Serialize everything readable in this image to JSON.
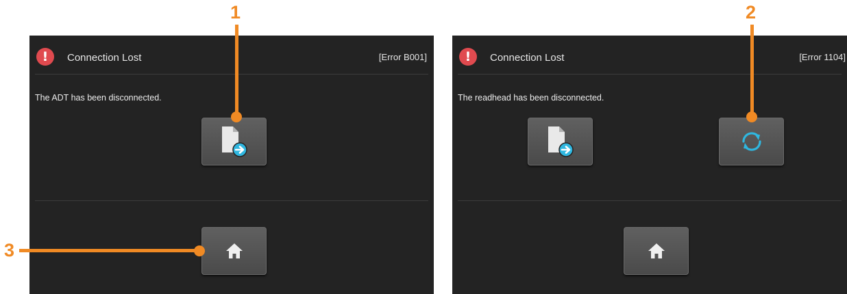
{
  "callouts": [
    {
      "label": "1"
    },
    {
      "label": "2"
    },
    {
      "label": "3"
    }
  ],
  "screens": [
    {
      "title": "Connection Lost",
      "error_code": "[Error B001]",
      "message": "The ADT has been disconnected.",
      "buttons": [
        "export-report-icon",
        "home-icon"
      ]
    },
    {
      "title": "Connection Lost",
      "error_code": "[Error 1104]",
      "message": "The readhead has been disconnected.",
      "buttons": [
        "export-report-icon",
        "refresh-icon",
        "home-icon"
      ]
    }
  ],
  "colors": {
    "callout": "#f08a24",
    "error_icon": "#e04a4f",
    "accent_cyan": "#2fb7e0",
    "panel_bg": "#232323"
  }
}
